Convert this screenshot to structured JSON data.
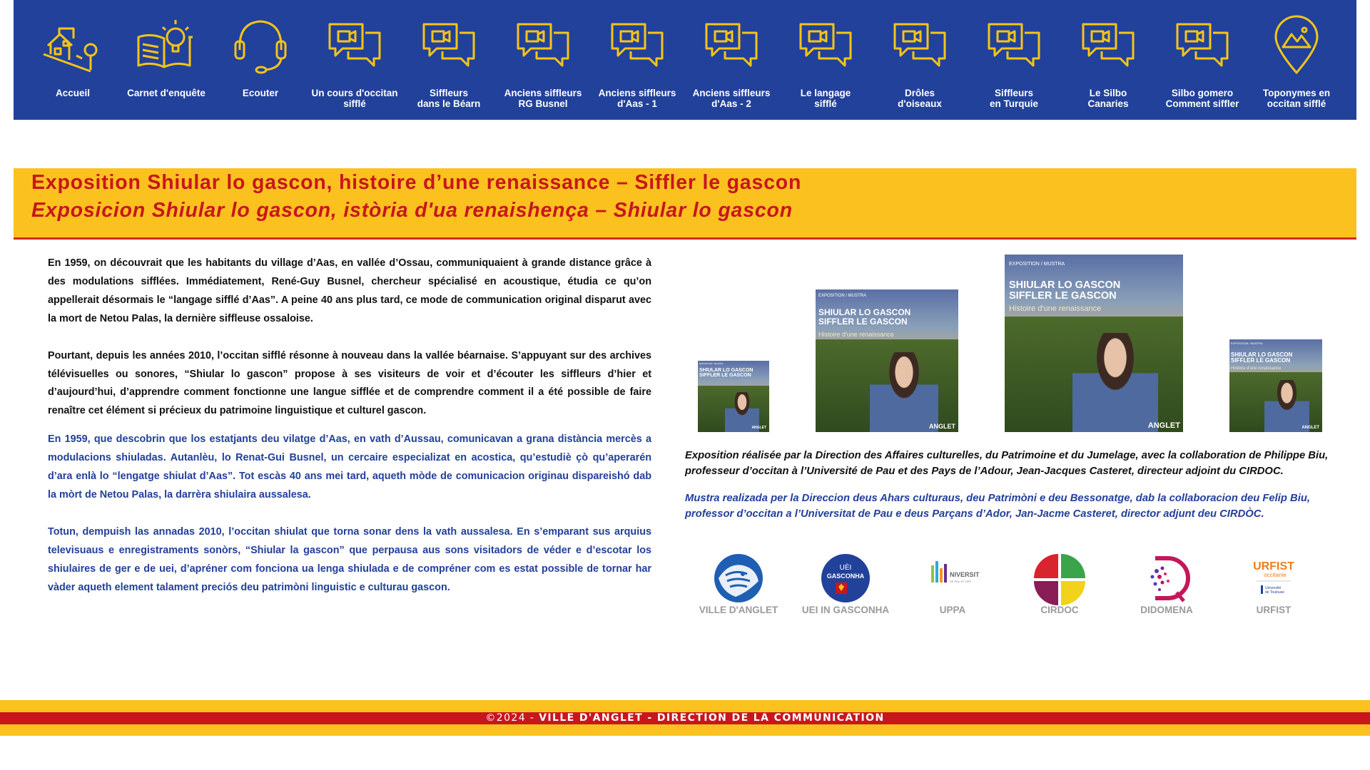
{
  "colors": {
    "nav_bg": "#22419a",
    "icon": "#f5c518",
    "band": "#fbc11e",
    "title": "#c8161d",
    "occitan_text": "#23409a",
    "footer_red": "#c8161d"
  },
  "nav": [
    {
      "label": "Accueil",
      "icon": "house-hill-icon"
    },
    {
      "label": "Carnet d'enquête",
      "icon": "book-lightbulb-icon"
    },
    {
      "label": "Ecouter",
      "icon": "headset-icon"
    },
    {
      "label": "Un cours d'occitan\nsifflé",
      "icon": "video-chat-icon"
    },
    {
      "label": "Siffleurs\ndans le Béarn",
      "icon": "video-chat-icon"
    },
    {
      "label": "Anciens siffleurs\nRG Busnel",
      "icon": "video-chat-icon"
    },
    {
      "label": "Anciens siffleurs\nd'Aas - 1",
      "icon": "video-chat-icon"
    },
    {
      "label": "Anciens siffleurs\nd'Aas - 2",
      "icon": "video-chat-icon"
    },
    {
      "label": "Le langage\nsifflé",
      "icon": "video-chat-icon"
    },
    {
      "label": "Drôles\nd'oiseaux",
      "icon": "video-chat-icon"
    },
    {
      "label": "Siffleurs\nen Turquie",
      "icon": "video-chat-icon"
    },
    {
      "label": "Le Silbo\nCanaries",
      "icon": "video-chat-icon"
    },
    {
      "label": "Silbo gomero\nComment siffler",
      "icon": "video-chat-icon"
    },
    {
      "label": "Toponymes en\noccitan sifflé",
      "icon": "map-pin-mountain-icon"
    }
  ],
  "title": {
    "fr": "Exposition Shiular lo gascon, histoire d’une renaissance – Siffler le gascon",
    "oc": "Exposicion Shiular lo gascon, istòria d'ua renaishença – Shiular lo gascon"
  },
  "paragraphs": {
    "fr1": "En 1959, on découvrait que les habitants du village d’Aas, en vallée d’Ossau, communiquaient à grande distance grâce à des modulations sifflées. Immédiatement, René-Guy Busnel, chercheur spécialisé en acoustique, étudia ce qu’on appellerait désormais le “langage sifflé d’Aas”. A peine 40 ans plus tard, ce mode de communication original disparut avec la mort de Netou Palas, la dernière siffleuse ossaloise.",
    "fr2": "Pourtant, depuis les années 2010, l’occitan sifflé résonne à nouveau dans la vallée béarnaise. S’appuyant sur des archives télévisuelles ou sonores, “Shiular lo gascon” propose à ses visiteurs de voir et d’écouter les siffleurs d’hier et d’aujourd’hui, d’apprendre comment fonctionne une langue sifflée et de comprendre comment il a été possible de faire renaître cet élément si précieux du patrimoine linguistique et culturel gascon.",
    "oc1": "En 1959, que descobrin que los estatjants deu vilatge d’Aas, en vath d’Aussau, comunicavan a grana distància mercès a modulacions shiuladas. Autanlèu, lo Renat-Gui Busnel, un cercaire especializat en acostica, qu’estudiè çò qu’aperarén d’ara enlà lo “lengatge shiulat d’Aas”. Tot escàs 40 ans mei tard, aqueth mòde de comunicacion originau dispareishó dab la mòrt de Netou Palas, la darrèra shiulaira aussalesa.",
    "oc2": "Totun, dempuish las annadas 2010, l’occitan shiulat que torna sonar dens la vath aussalesa. En s’emparant sus arquius televisuaus e enregistraments sonòrs, “Shiular la gascon” que perpausa aus sons visitadors de véder e d’escotar los shiulaires de ger e de uei, d’apréner com fonciona ua lenga shiulada e de compréner com es estat possible de tornar har vàder aqueth element talament preciós deu patrimòni linguistic e culturau gascon."
  },
  "poster": {
    "kicker": "EXPOSITION / MUSTRA",
    "title_line1": "SHIULAR LO GASCON",
    "title_line2": "SIFFLER LE GASCON",
    "subtitle": "Histoire d'une renaissance",
    "logo": "ANGLET"
  },
  "credit": {
    "fr": "Exposition réalisée par la Direction des Affaires culturelles, du Patrimoine et du Jumelage, avec la collaboration de Philippe Biu, professeur d’occitan à l’Université de Pau et des Pays de l’Adour, Jean-Jacques Casteret, directeur adjoint du CIRDOC.",
    "oc": "Mustra realizada per la Direccion deus Ahars culturaus, deu Patrimòni e deu Bessonatge, dab la collaboracion deu Felip Biu, professor d’occitan a l’Universitat de Pau e deus Parçans d’Ador, Jan-Jacme Casteret, director adjunt deu CIRDÒC."
  },
  "partners": [
    {
      "name": "VILLE D'ANGLET"
    },
    {
      "name": "UEI IN GASCONHA",
      "logo_text": "UÈI\nGASCONHA"
    },
    {
      "name": "UPPA",
      "logo_text": "NIVERSITÉ"
    },
    {
      "name": "CIRDOC"
    },
    {
      "name": "DIDOMENA"
    },
    {
      "name": "URFIST",
      "logo_text": "URFIST",
      "logo_sub": "occitanie"
    }
  ],
  "footer": {
    "year": "©2024 - ",
    "org": "VILLE D'ANGLET - DIRECTION DE LA COMMUNICATION"
  }
}
